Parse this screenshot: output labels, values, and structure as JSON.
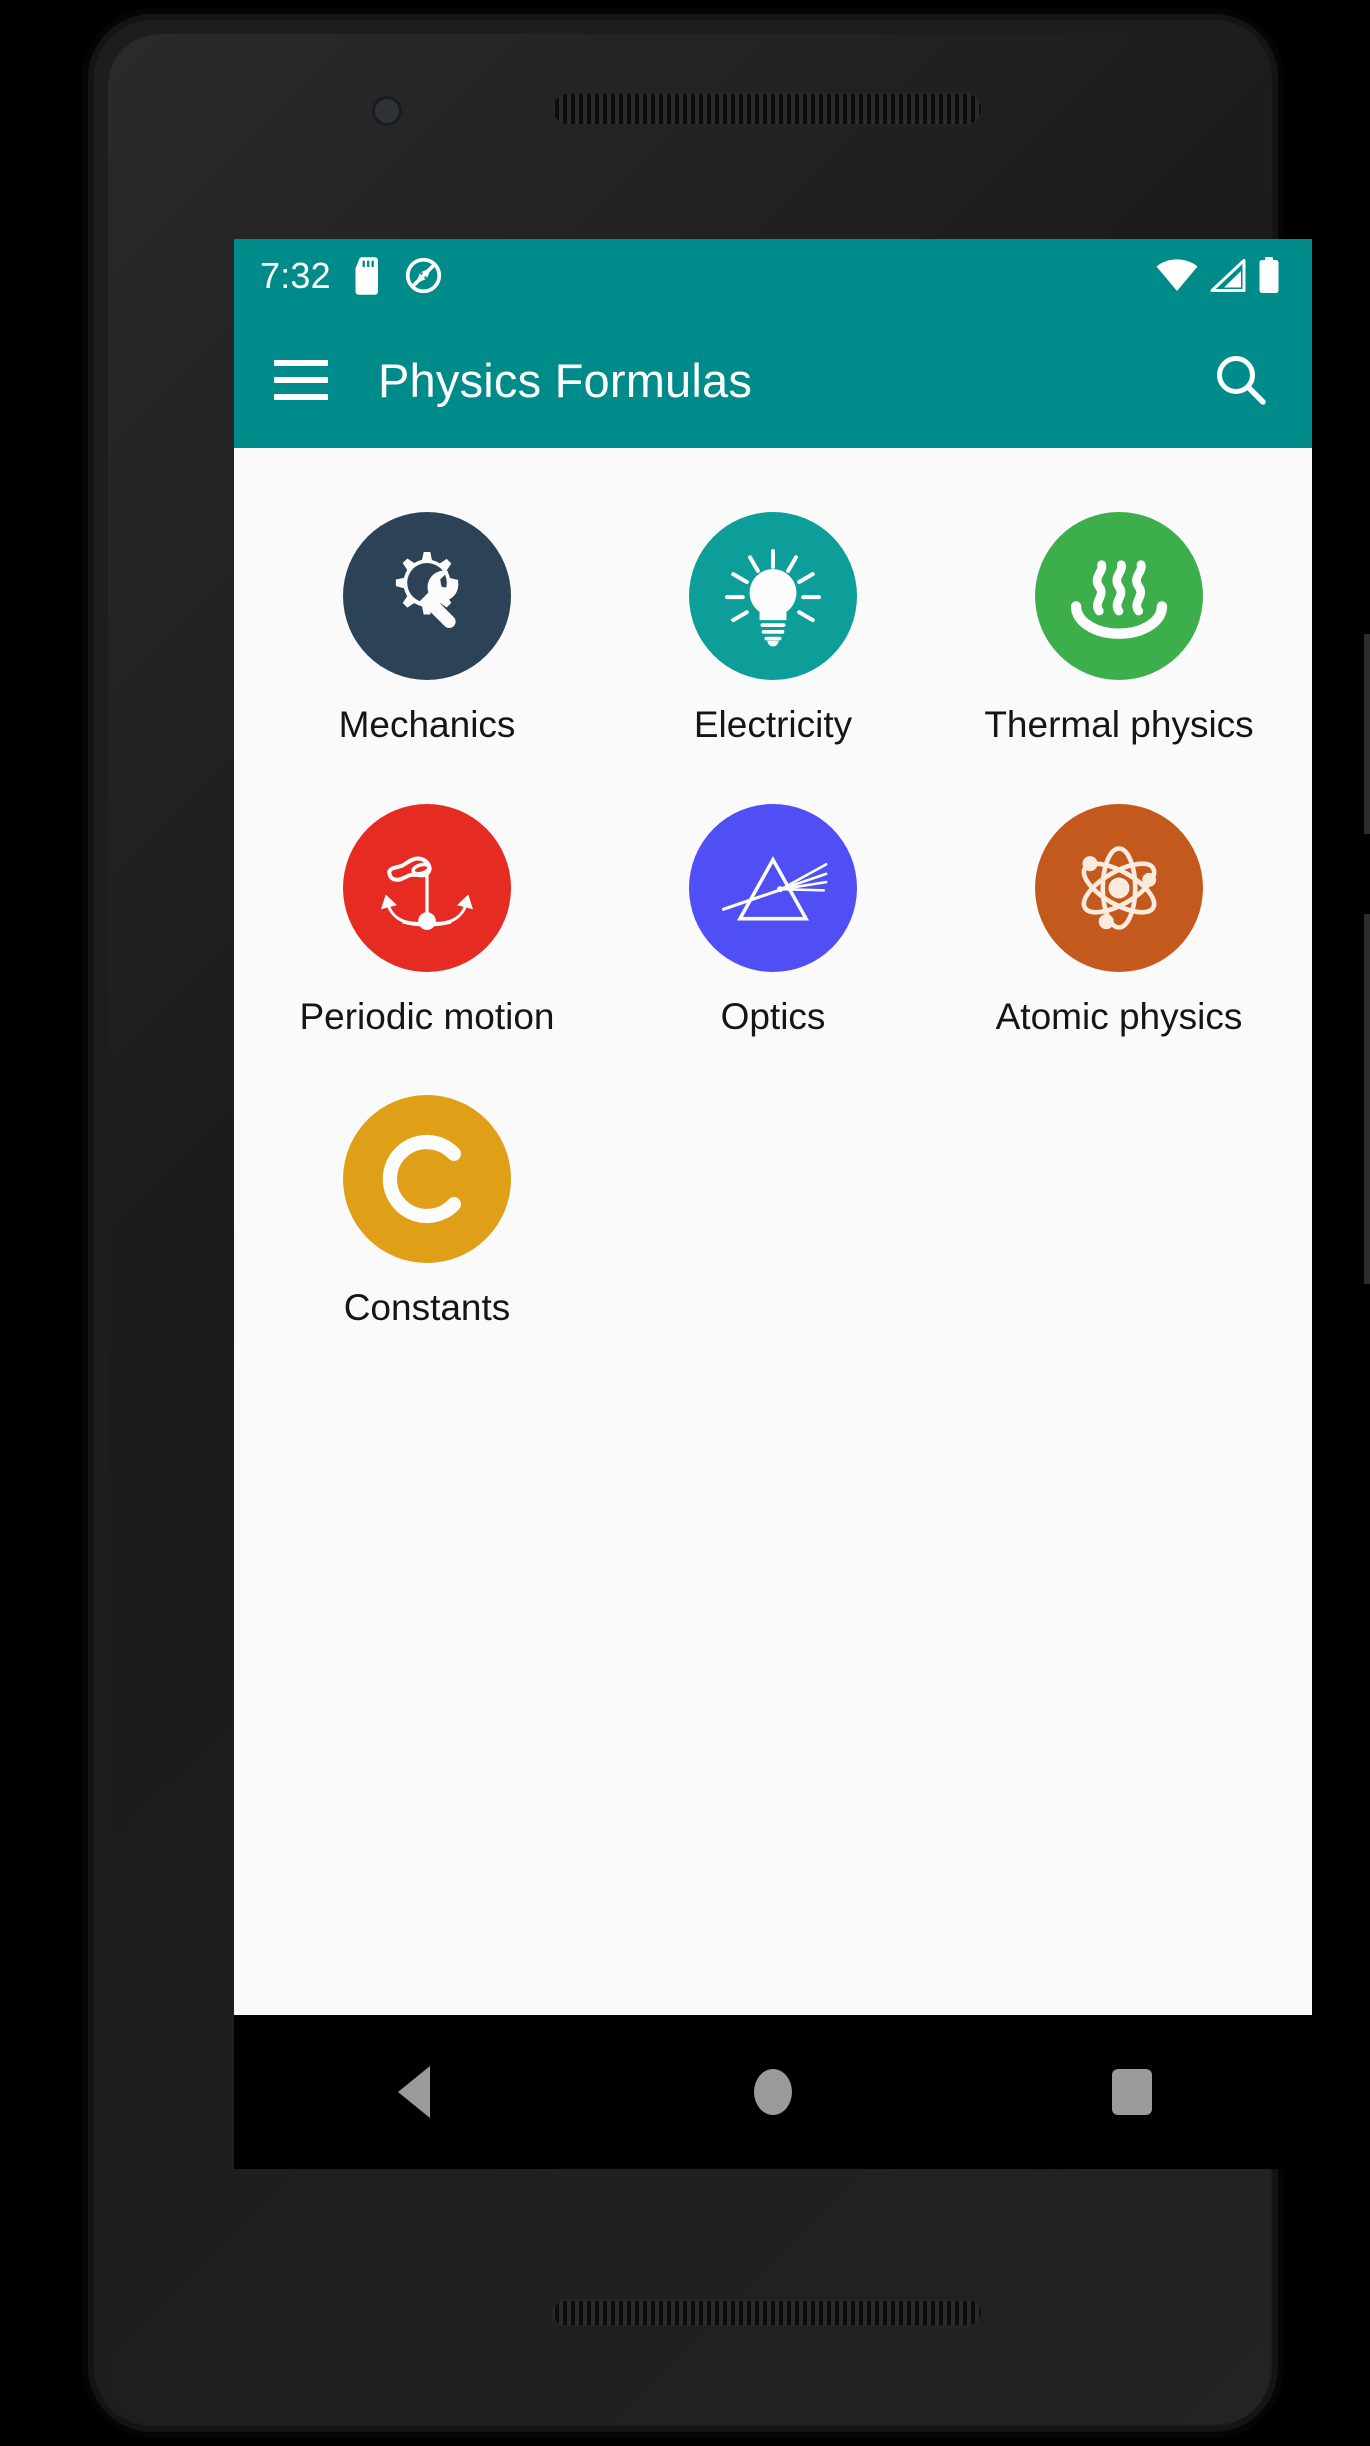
{
  "status_bar": {
    "clock": "7:32",
    "left_icons": [
      "sd-card-icon",
      "location-off-icon"
    ],
    "right_icons": [
      "wifi-icon",
      "cellular-signal-icon",
      "battery-full-icon"
    ],
    "background_color": "#008b8b"
  },
  "app_bar": {
    "menu_icon": "hamburger-menu-icon",
    "title": "Physics Formulas",
    "search_icon": "search-icon",
    "background_color": "#008b8b",
    "text_color": "#ffffff"
  },
  "content": {
    "background_color": "#fafafa",
    "categories": [
      {
        "label": "Mechanics",
        "icon": "gear-wrench-icon",
        "color": "#2b4257"
      },
      {
        "label": "Electricity",
        "icon": "light-bulb-icon",
        "color": "#0d9e99"
      },
      {
        "label": "Thermal physics",
        "icon": "hot-steam-icon",
        "color": "#3cae4b"
      },
      {
        "label": "Periodic motion",
        "icon": "pendulum-icon",
        "color": "#e62b22"
      },
      {
        "label": "Optics",
        "icon": "prism-icon",
        "color": "#4f4ff5"
      },
      {
        "label": "Atomic physics",
        "icon": "atom-icon",
        "color": "#c4591d"
      },
      {
        "label": "Constants",
        "icon": "letter-c-icon",
        "color": "#dfa018"
      }
    ]
  },
  "navigation_bar": {
    "background_color": "#000000",
    "icon_color": "#9a9a9a",
    "buttons": [
      {
        "name": "back",
        "icon": "triangle-back-icon"
      },
      {
        "name": "home",
        "icon": "circle-home-icon"
      },
      {
        "name": "recents",
        "icon": "square-recents-icon"
      }
    ]
  }
}
